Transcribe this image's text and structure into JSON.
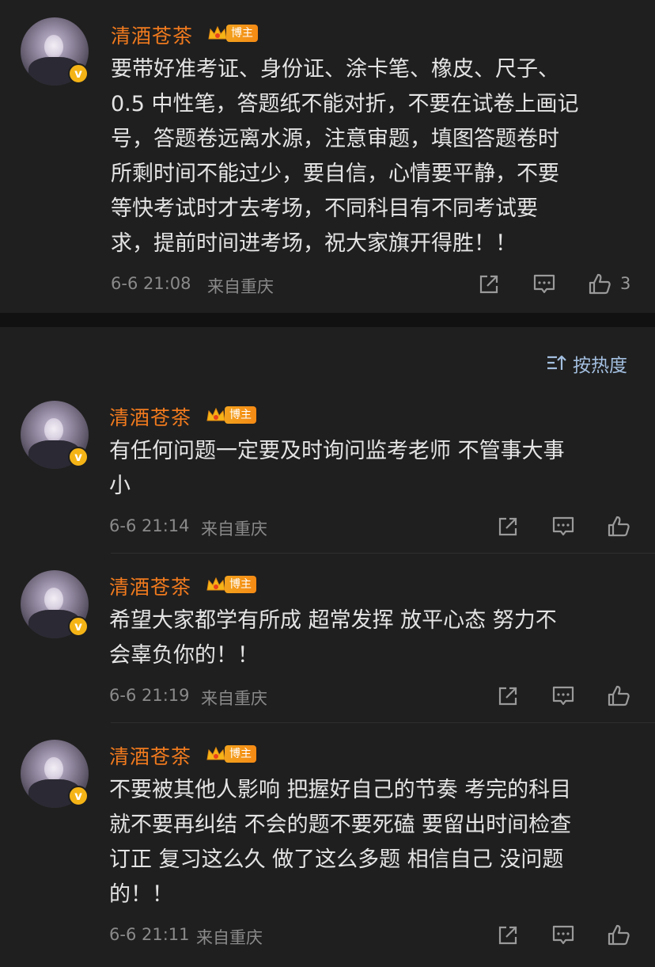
{
  "post": {
    "username": "清酒苍茶",
    "tag": "博主",
    "text_lines": [
      "要带好准考证、身份证、涂卡笔、橡皮、尺子、",
      "0.5 中性笔，答题纸不能对折，不要在试卷上画记",
      "号，答题卷远离水源，注意审题，填图答题卷时",
      "所剩时间不能过少，要自信，心情要平静，不要",
      "等快考试时才去考场，不同科目有不同考试要",
      "求，提前时间进考场，祝大家旗开得胜！！"
    ],
    "time": "6-6 21:08",
    "location": "来自重庆",
    "like_count": "3"
  },
  "sort": {
    "label": "按热度"
  },
  "comments": [
    {
      "username": "清酒苍茶",
      "tag": "博主",
      "text_lines": [
        "有任何问题一定要及时询问监考老师 不管事大事",
        "小"
      ],
      "time": "6-6 21:14",
      "location": "来自重庆"
    },
    {
      "username": "清酒苍茶",
      "tag": "博主",
      "text_lines": [
        "希望大家都学有所成 超常发挥 放平心态 努力不",
        "会辜负你的！！"
      ],
      "time": "6-6 21:19",
      "location": "来自重庆"
    },
    {
      "username": "清酒苍茶",
      "tag": "博主",
      "text_lines": [
        "不要被其他人影响 把握好自己的节奏 考完的科目",
        "就不要再纠结 不会的题不要死磕 要留出时间检查",
        "订正 复习这么久 做了这么多题 相信自己 没问题",
        "的！！"
      ],
      "time": "6-6 21:11",
      "location": "来自重庆"
    }
  ],
  "icons": {
    "verified": "v-verified-badge",
    "crown": "crown-icon",
    "share": "share-icon",
    "comment": "comment-icon",
    "like": "thumbs-up-icon",
    "sort": "sort-icon"
  },
  "colors": {
    "background": "#1f1f1f",
    "username": "#f07a1e",
    "text": "#e4e4e4",
    "meta": "#8a8a8a",
    "sort_link": "#a3bfe0",
    "verified": "#f5b416"
  }
}
